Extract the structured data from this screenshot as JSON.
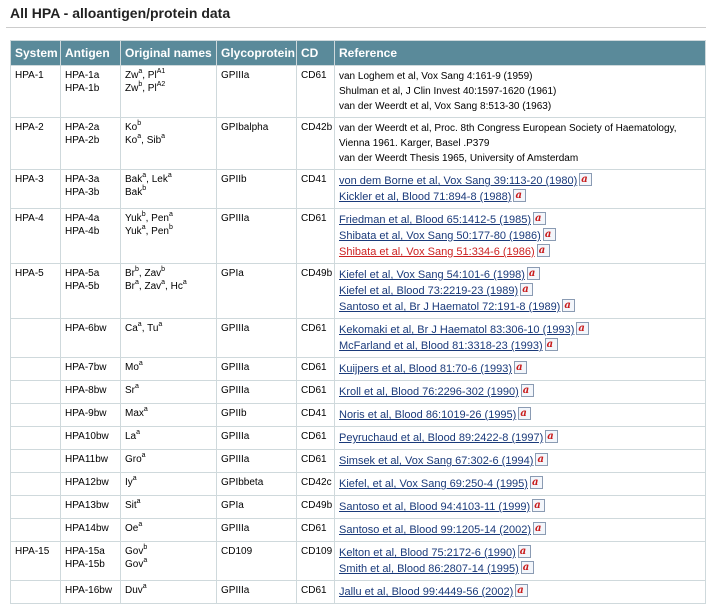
{
  "title": "All HPA - alloantigen/protein data",
  "headers": [
    "System",
    "Antigen",
    "Original names",
    "Glycoprotein",
    "CD",
    "Reference"
  ],
  "rows": [
    {
      "system": "HPA-1",
      "antigens": [
        "HPA-1a",
        "HPA-1b"
      ],
      "names": [
        [
          [
            "Zw",
            "a"
          ],
          [
            ", Pl",
            ""
          ],
          [
            "",
            "A1"
          ]
        ],
        [
          [
            "Zw",
            "b"
          ],
          [
            ", Pl",
            ""
          ],
          [
            "",
            "A2"
          ]
        ]
      ],
      "glyco": "GPIIIa",
      "cd": "CD61",
      "refs": [
        {
          "t": "van Loghem et al, Vox Sang 4:161-9 (1959)",
          "link": false
        },
        {
          "t": "Shulman et al, J Clin Invest 40:1597-1620 (1961)",
          "link": false
        },
        {
          "t": "van der Weerdt et al, Vox Sang 8:513-30 (1963)",
          "link": false
        }
      ]
    },
    {
      "system": "HPA-2",
      "antigens": [
        "HPA-2a",
        "HPA-2b"
      ],
      "names": [
        [
          [
            "Ko",
            "b"
          ]
        ],
        [
          [
            "Ko",
            "a"
          ],
          [
            ", Sib",
            "a"
          ]
        ]
      ],
      "glyco": "GPIbalpha",
      "cd": "CD42b",
      "refs": [
        {
          "t": "van der Weerdt et al, Proc. 8th Congress European Society of Haematology,",
          "link": false
        },
        {
          "t": "Vienna 1961. Karger, Basel .P379",
          "link": false
        },
        {
          "t": "van der Weerdt Thesis 1965, University of Amsterdam",
          "link": false
        }
      ]
    },
    {
      "system": "HPA-3",
      "antigens": [
        "HPA-3a",
        "HPA-3b"
      ],
      "names": [
        [
          [
            "Bak",
            "a"
          ],
          [
            ", Lek",
            "a"
          ]
        ],
        [
          [
            "Bak",
            "b"
          ]
        ]
      ],
      "glyco": "GPIIb",
      "cd": "CD41",
      "refs": [
        {
          "t": "von dem Borne et al, Vox Sang 39:113-20 (1980)",
          "link": true,
          "pdf": "a"
        },
        {
          "t": "Kickler et al, Blood 71:894-8 (1988)",
          "link": true,
          "pdf": "a"
        }
      ]
    },
    {
      "system": "HPA-4",
      "antigens": [
        "HPA-4a",
        "HPA-4b"
      ],
      "names": [
        [
          [
            "Yuk",
            "b"
          ],
          [
            ", Pen",
            "a"
          ]
        ],
        [
          [
            "Yuk",
            "a"
          ],
          [
            ", Pen",
            "b"
          ]
        ]
      ],
      "glyco": "GPIIIa",
      "cd": "CD61",
      "refs": [
        {
          "t": "Friedman et al, Blood 65:1412-5 (1985)",
          "link": true,
          "pdf": "a"
        },
        {
          "t": "Shibata et al, Vox Sang 50:177-80 (1986)",
          "link": true,
          "pdf": "a"
        },
        {
          "t": "Shibata et al, Vox Sang 51:334-6 (1986)",
          "link": true,
          "red": true,
          "pdf": "a"
        }
      ]
    },
    {
      "system": "HPA-5",
      "antigens": [
        "HPA-5a",
        "HPA-5b"
      ],
      "names": [
        [
          [
            "Br",
            "b"
          ],
          [
            ", Zav",
            "b"
          ]
        ],
        [
          [
            "Br",
            "a"
          ],
          [
            ", Zav",
            "a"
          ],
          [
            ", Hc",
            "a"
          ]
        ]
      ],
      "glyco": "GPIa",
      "cd": "CD49b",
      "refs": [
        {
          "t": "Kiefel et al, Vox Sang 54:101-6 (1998)",
          "link": true,
          "pdf": "a"
        },
        {
          "t": "Kiefel et al, Blood 73:2219-23 (1989)",
          "link": true,
          "pdf": "a"
        },
        {
          "t": "Santoso et al, Br J Haematol 72:191-8 (1989)",
          "link": true,
          "pdf": "a"
        }
      ]
    },
    {
      "system": "",
      "antigens": [
        "HPA-6bw"
      ],
      "names": [
        [
          [
            "Ca",
            "a"
          ],
          [
            ", Tu",
            "a"
          ]
        ]
      ],
      "glyco": "GPIIIa",
      "cd": "CD61",
      "refs": [
        {
          "t": "Kekomaki et al, Br J Haematol 83:306-10 (1993)",
          "link": true,
          "pdf": "a"
        },
        {
          "t": "McFarland et al, Blood 81:3318-23 (1993)",
          "link": true,
          "pdf": "a"
        }
      ]
    },
    {
      "system": "",
      "antigens": [
        "HPA-7bw"
      ],
      "names": [
        [
          [
            "Mo",
            "a"
          ]
        ]
      ],
      "glyco": "GPIIIa",
      "cd": "CD61",
      "refs": [
        {
          "t": "Kuijpers et al, Blood 81:70-6 (1993)",
          "link": true,
          "pdf": "a"
        }
      ]
    },
    {
      "system": "",
      "antigens": [
        "HPA-8bw"
      ],
      "names": [
        [
          [
            "Sr",
            "a"
          ]
        ]
      ],
      "glyco": "GPIIIa",
      "cd": "CD61",
      "refs": [
        {
          "t": "Kroll et al, Blood 76:2296-302 (1990)",
          "link": true,
          "pdf": "a"
        }
      ]
    },
    {
      "system": "",
      "antigens": [
        "HPA-9bw"
      ],
      "names": [
        [
          [
            "Max",
            "a"
          ]
        ]
      ],
      "glyco": "GPIIb",
      "cd": "CD41",
      "refs": [
        {
          "t": "Noris et al, Blood 86:1019-26 (1995)",
          "link": true,
          "pdf": "a"
        }
      ]
    },
    {
      "system": "",
      "antigens": [
        "HPA10bw"
      ],
      "names": [
        [
          [
            "La",
            "a"
          ]
        ]
      ],
      "glyco": "GPIIIa",
      "cd": "CD61",
      "refs": [
        {
          "t": "Peyruchaud et al, Blood 89:2422-8 (1997)",
          "link": true,
          "pdf": "a"
        }
      ]
    },
    {
      "system": "",
      "antigens": [
        "HPA11bw"
      ],
      "names": [
        [
          [
            "Gro",
            "a"
          ]
        ]
      ],
      "glyco": "GPIIIa",
      "cd": "CD61",
      "refs": [
        {
          "t": "Simsek et al, Vox Sang 67:302-6 (1994)",
          "link": true,
          "pdf": "a"
        }
      ]
    },
    {
      "system": "",
      "antigens": [
        "HPA12bw"
      ],
      "names": [
        [
          [
            "Iy",
            "a"
          ]
        ]
      ],
      "glyco": "GPIbbeta",
      "cd": "CD42c",
      "refs": [
        {
          "t": "Kiefel, et al, Vox Sang 69:250-4 (1995)",
          "link": true,
          "pdf": "a"
        }
      ]
    },
    {
      "system": "",
      "antigens": [
        "HPA13bw"
      ],
      "names": [
        [
          [
            "Sit",
            "a"
          ]
        ]
      ],
      "glyco": "GPIa",
      "cd": "CD49b",
      "refs": [
        {
          "t": "Santoso et al, Blood 94:4103-11 (1999)",
          "link": true,
          "pdf": "a"
        }
      ]
    },
    {
      "system": "",
      "antigens": [
        "HPA14bw"
      ],
      "names": [
        [
          [
            "Oe",
            "a"
          ]
        ]
      ],
      "glyco": "GPIIIa",
      "cd": "CD61",
      "refs": [
        {
          "t": "Santoso et al, Blood 99:1205-14 (2002)",
          "link": true,
          "pdf": "a"
        }
      ]
    },
    {
      "system": "HPA-15",
      "antigens": [
        "HPA-15a",
        "HPA-15b"
      ],
      "names": [
        [
          [
            "Gov",
            "b"
          ]
        ],
        [
          [
            "Gov",
            "a"
          ]
        ]
      ],
      "glyco": "CD109",
      "cd": "CD109",
      "refs": [
        {
          "t": "Kelton et al, Blood 75:2172-6 (1990)",
          "link": true,
          "pdf": "a"
        },
        {
          "t": "Smith et al, Blood 86:2807-14 (1995)",
          "link": true,
          "pdf": "a"
        }
      ]
    },
    {
      "system": "",
      "antigens": [
        "HPA-16bw"
      ],
      "names": [
        [
          [
            "Duv",
            "a"
          ]
        ]
      ],
      "glyco": "GPIIIa",
      "cd": "CD61",
      "refs": [
        {
          "t": "Jallu et al, Blood 99:4449-56 (2002)",
          "link": true,
          "pdf": "a"
        }
      ]
    }
  ],
  "colors": {
    "header_bg": "#5a8a9a",
    "link": "#1a3a7a",
    "link_alt": "#cc2222",
    "pdf_glyph": "#c81a1a"
  },
  "icons": {
    "pdf": "pdf-document-icon"
  }
}
